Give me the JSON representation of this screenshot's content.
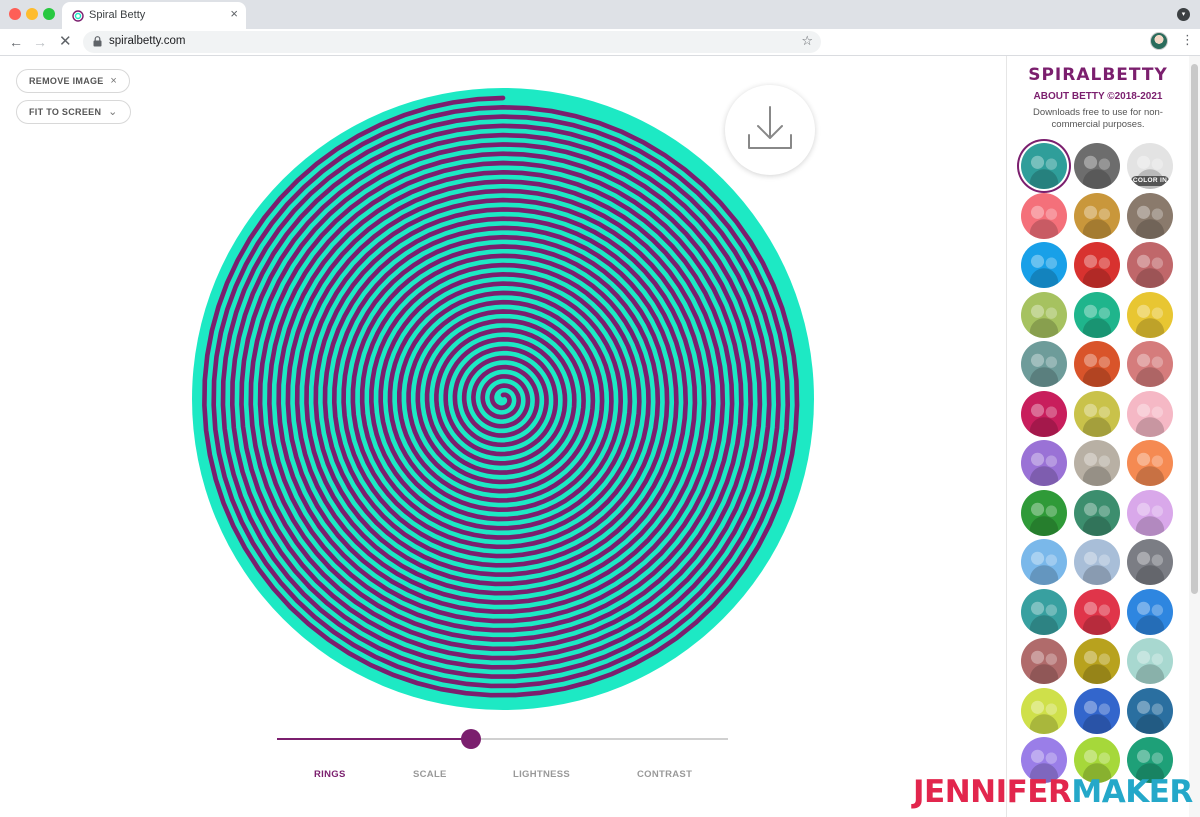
{
  "browser": {
    "tab_title": "Spiral Betty",
    "tab_close": "×",
    "url": "spiralbetty.com"
  },
  "toolbar": {
    "remove_image_label": "REMOVE IMAGE",
    "remove_image_icon": "×",
    "fit_label": "FIT TO SCREEN",
    "fit_icon": "⌄"
  },
  "spiral": {
    "background_color": "#1de9c4",
    "line_color": "#7b1f6e",
    "rings": 32
  },
  "slider": {
    "value_fraction": 0.43
  },
  "modes": {
    "rings": "RINGS",
    "scale": "SCALE",
    "lightness": "LIGHTNESS",
    "contrast": "CONTRAST",
    "active": "RINGS"
  },
  "sidebar": {
    "brand_a": "SPIRAL",
    "brand_b": "BETTY",
    "about": "ABOUT BETTY ©2018-2021",
    "notice": "Downloads free to use for non-commercial purposes.",
    "color_in_label": "COLOR IN",
    "swatches": [
      {
        "bg": "#2f9e9a",
        "selected": true
      },
      {
        "bg": "#6d6d6d"
      },
      {
        "bg": "#e3e3e3"
      },
      {
        "bg": "#f4707a"
      },
      {
        "bg": "#c9973b"
      },
      {
        "bg": "#8a7a6c"
      },
      {
        "bg": "#18a0e8"
      },
      {
        "bg": "#d8322f"
      },
      {
        "bg": "#c0676a"
      },
      {
        "bg": "#a6c260"
      },
      {
        "bg": "#1fb58c"
      },
      {
        "bg": "#e8c632"
      },
      {
        "bg": "#6e9c9a"
      },
      {
        "bg": "#d9542a"
      },
      {
        "bg": "#d57c7c"
      },
      {
        "bg": "#c81e5c"
      },
      {
        "bg": "#c9c24a"
      },
      {
        "bg": "#f5b8c5"
      },
      {
        "bg": "#9a72d6"
      },
      {
        "bg": "#b8b0a4"
      },
      {
        "bg": "#f58a52"
      },
      {
        "bg": "#2f9a38"
      },
      {
        "bg": "#3c8e6e"
      },
      {
        "bg": "#d9a8ea"
      },
      {
        "bg": "#7ab8ea"
      },
      {
        "bg": "#a8bed8"
      },
      {
        "bg": "#7b7d84"
      },
      {
        "bg": "#38a0a0"
      },
      {
        "bg": "#e0354a"
      },
      {
        "bg": "#2e86e0"
      },
      {
        "bg": "#b06b6b"
      },
      {
        "bg": "#b8a21e"
      },
      {
        "bg": "#a8d8d0"
      },
      {
        "bg": "#cfe04a"
      },
      {
        "bg": "#3366cc"
      },
      {
        "bg": "#2a6fa0"
      },
      {
        "bg": "#9a7ee8"
      },
      {
        "bg": "#a6d83a"
      },
      {
        "bg": "#1ea078"
      }
    ]
  },
  "watermark": {
    "part_a": "JENNIFER",
    "part_b": "MAKER"
  }
}
